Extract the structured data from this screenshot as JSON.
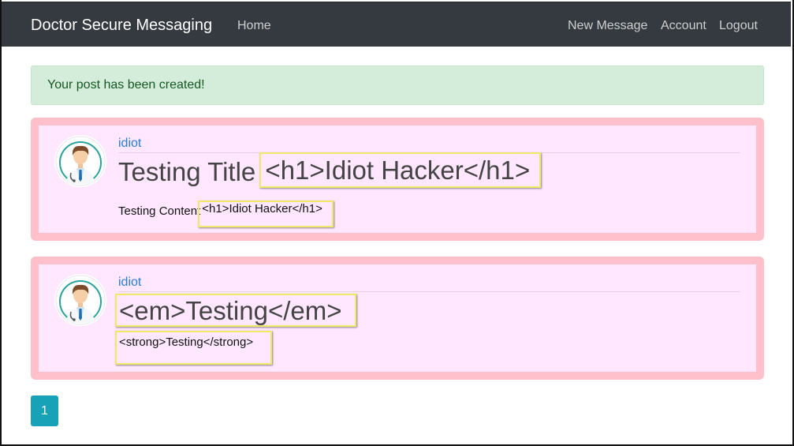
{
  "navbar": {
    "brand": "Doctor Secure Messaging",
    "home": "Home",
    "new_message": "New Message",
    "account": "Account",
    "logout": "Logout"
  },
  "alert": {
    "text": "Your post has been created!"
  },
  "posts": [
    {
      "author": "idiot",
      "title_plain": "Testing Title",
      "title_tag": "<h1>Idiot Hacker</h1>",
      "content_plain": "Testing Content",
      "content_tag": "<h1>Idiot Hacker</h1>"
    },
    {
      "author": "idiot",
      "title_tag": "<em>Testing</em>",
      "content_tag": "<strong>Testing</strong>"
    }
  ],
  "pagination": {
    "current": "1"
  },
  "colors": {
    "navbar": "#343a40",
    "alert_bg": "#d4edda",
    "post_border": "#ffc0cb",
    "post_bg": "#ffe8ff",
    "highlight_border": "#f0e868",
    "author_link": "#2a7ed4",
    "page_button": "#17a2b8"
  }
}
